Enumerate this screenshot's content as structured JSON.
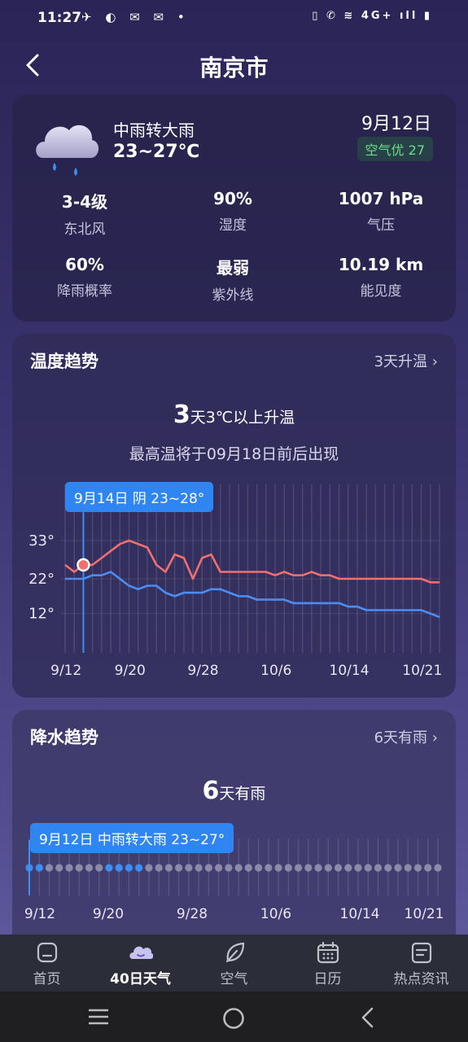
{
  "status_bar": {
    "time": "11:27",
    "left_icons": "✈ ◐ ✉ ✉ •",
    "right_icons": "▯ ✆ ≋ 4G+ ıll ▮"
  },
  "header": {
    "title": "南京市"
  },
  "current": {
    "condition": "中雨转大雨",
    "temp_range": "23~27℃",
    "date": "9月12日",
    "aqi": "空气优 27",
    "stats": [
      {
        "value": "3-4级",
        "label": "东北风"
      },
      {
        "value": "90%",
        "label": "湿度"
      },
      {
        "value": "1007 hPa",
        "label": "气压"
      },
      {
        "value": "60%",
        "label": "降雨概率"
      },
      {
        "value": "最弱",
        "label": "紫外线"
      },
      {
        "value": "10.19 km",
        "label": "能见度"
      }
    ]
  },
  "temp_trend": {
    "title": "温度趋势",
    "link": "3天升温",
    "headline_num": "3",
    "headline_rest": "天3℃以上升温",
    "subline": "最高温将于09月18日前后出现",
    "tooltip": "9月14日 阴 23~28°"
  },
  "rain_trend": {
    "title": "降水趋势",
    "link": "6天有雨",
    "headline_num": "6",
    "headline_rest": "天有雨",
    "tooltip": "9月12日 中雨转大雨 23~27°"
  },
  "chart_data": [
    {
      "type": "line",
      "title": "温度趋势",
      "x_tick_labels": [
        "9/12",
        "9/20",
        "9/28",
        "10/6",
        "10/14",
        "10/21"
      ],
      "y_tick_labels": [
        "33°",
        "22°",
        "12°"
      ],
      "y_ticks": [
        33,
        22,
        12
      ],
      "series": [
        {
          "values": [
            26,
            24,
            26,
            26,
            28,
            30,
            32,
            33,
            32,
            31,
            26,
            24,
            29,
            28,
            22,
            28,
            29,
            24,
            24,
            24,
            24,
            24,
            24,
            23,
            24,
            23,
            23,
            24,
            23,
            23,
            22,
            22,
            22,
            22,
            22,
            22,
            22,
            22,
            22,
            22,
            21,
            21
          ]
        },
        {
          "values": [
            22,
            22,
            22,
            23,
            23,
            24,
            22,
            20,
            19,
            20,
            20,
            18,
            17,
            18,
            18,
            18,
            19,
            19,
            18,
            17,
            17,
            16,
            16,
            16,
            16,
            15,
            15,
            15,
            15,
            15,
            15,
            14,
            14,
            13,
            13,
            13,
            13,
            13,
            13,
            13,
            12,
            11
          ]
        }
      ],
      "colors": {
        "high": "#f07070",
        "low": "#4a8ef5"
      }
    },
    {
      "type": "scatter",
      "title": "降水趋势",
      "x_tick_labels": [
        "9/12",
        "9/20",
        "9/28",
        "10/6",
        "10/14",
        "10/21"
      ],
      "rain_days": [
        1,
        1,
        0,
        0,
        0,
        0,
        0,
        0,
        1,
        1,
        1,
        1,
        0,
        0,
        0,
        0,
        0,
        0,
        0,
        0,
        0,
        0,
        0,
        0,
        0,
        0,
        0,
        0,
        0,
        0,
        0,
        0,
        0,
        0,
        0,
        0,
        0,
        0,
        0,
        0,
        0,
        0
      ],
      "colors": {
        "rain": "#3d8ef5",
        "dry": "#8c8aa8"
      }
    }
  ],
  "nav": {
    "items": [
      {
        "label": "首页",
        "icon": "home-icon"
      },
      {
        "label": "40日天气",
        "icon": "cloud-icon"
      },
      {
        "label": "空气",
        "icon": "leaf-icon"
      },
      {
        "label": "日历",
        "icon": "calendar-icon"
      },
      {
        "label": "热点资讯",
        "icon": "news-icon"
      }
    ]
  }
}
